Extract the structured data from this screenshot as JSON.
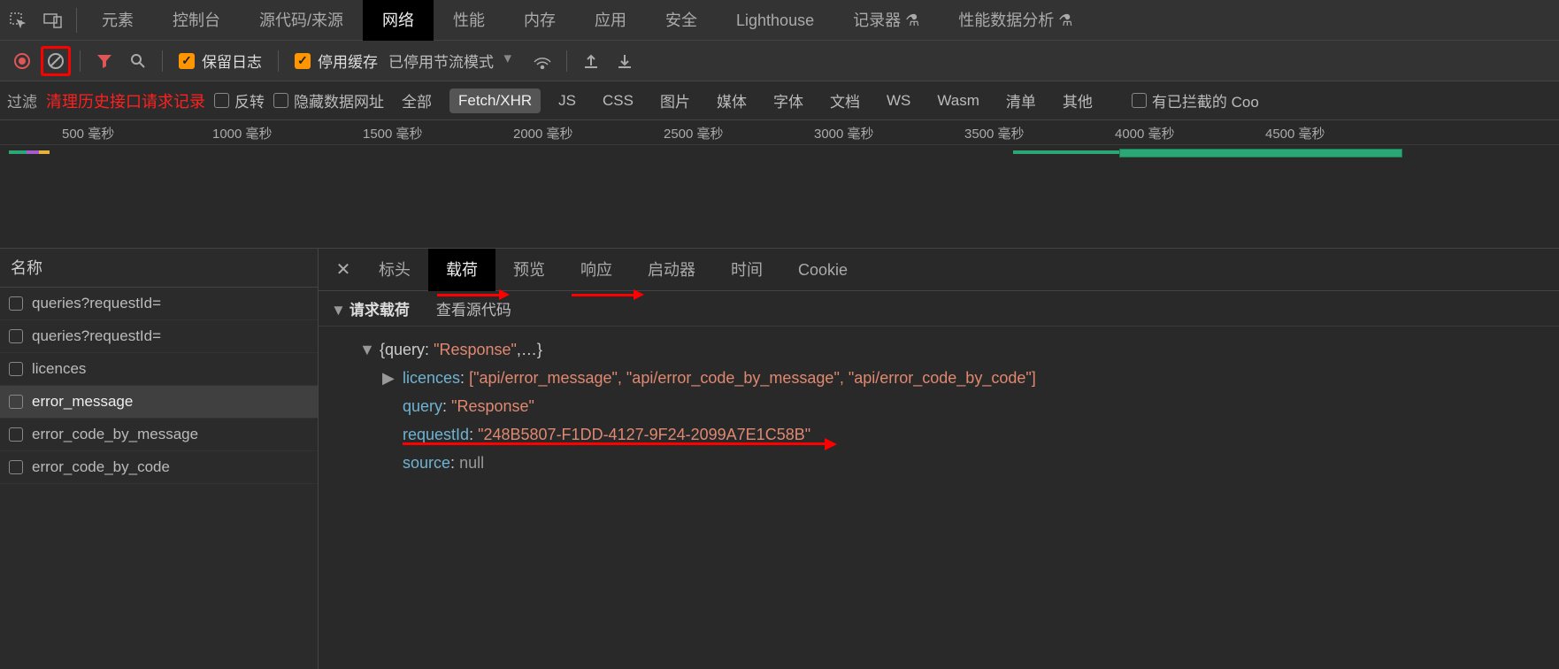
{
  "top_tabs": {
    "items": [
      "元素",
      "控制台",
      "源代码/来源",
      "网络",
      "性能",
      "内存",
      "应用",
      "安全",
      "Lighthouse",
      "记录器 ⚗",
      "性能数据分析 ⚗"
    ],
    "active_index": 3
  },
  "toolbar": {
    "preserve_log": "保留日志",
    "disable_cache": "停用缓存",
    "throttling": "已停用节流模式"
  },
  "annotation": {
    "clear_history": "清理历史接口请求记录"
  },
  "filter_bar": {
    "label": "过滤",
    "invert": "反转",
    "hide_data_urls": "隐藏数据网址",
    "types": [
      "全部",
      "Fetch/XHR",
      "JS",
      "CSS",
      "图片",
      "媒体",
      "字体",
      "文档",
      "WS",
      "Wasm",
      "清单",
      "其他"
    ],
    "active_type_index": 1,
    "blocked_label": "有已拦截的 Coo"
  },
  "timeline": {
    "ticks": [
      "500 毫秒",
      "1000 毫秒",
      "1500 毫秒",
      "2000 毫秒",
      "2500 毫秒",
      "3000 毫秒",
      "3500 毫秒",
      "4000 毫秒",
      "4500 毫秒"
    ]
  },
  "requests": {
    "header": "名称",
    "items": [
      {
        "name": "queries?requestId="
      },
      {
        "name": "queries?requestId="
      },
      {
        "name": "licences"
      },
      {
        "name": "error_message"
      },
      {
        "name": "error_code_by_message"
      },
      {
        "name": "error_code_by_code"
      }
    ],
    "selected_index": 3
  },
  "detail_tabs": {
    "items": [
      "标头",
      "载荷",
      "预览",
      "响应",
      "启动器",
      "时间",
      "Cookie"
    ],
    "active_index": 1
  },
  "payload_header": {
    "title": "请求载荷",
    "view_source": "查看源代码"
  },
  "payload": {
    "summary_prefix": "{query: ",
    "summary_value": "\"Response\"",
    "summary_suffix": ",…}",
    "licences_key": "licences",
    "licences_val": "[\"api/error_message\", \"api/error_code_by_message\", \"api/error_code_by_code\"]",
    "query_key": "query",
    "query_val": "\"Response\"",
    "requestId_key": "requestId",
    "requestId_val": "\"248B5807-F1DD-4127-9F24-2099A7E1C58B\"",
    "source_key": "source",
    "source_val": "null"
  }
}
